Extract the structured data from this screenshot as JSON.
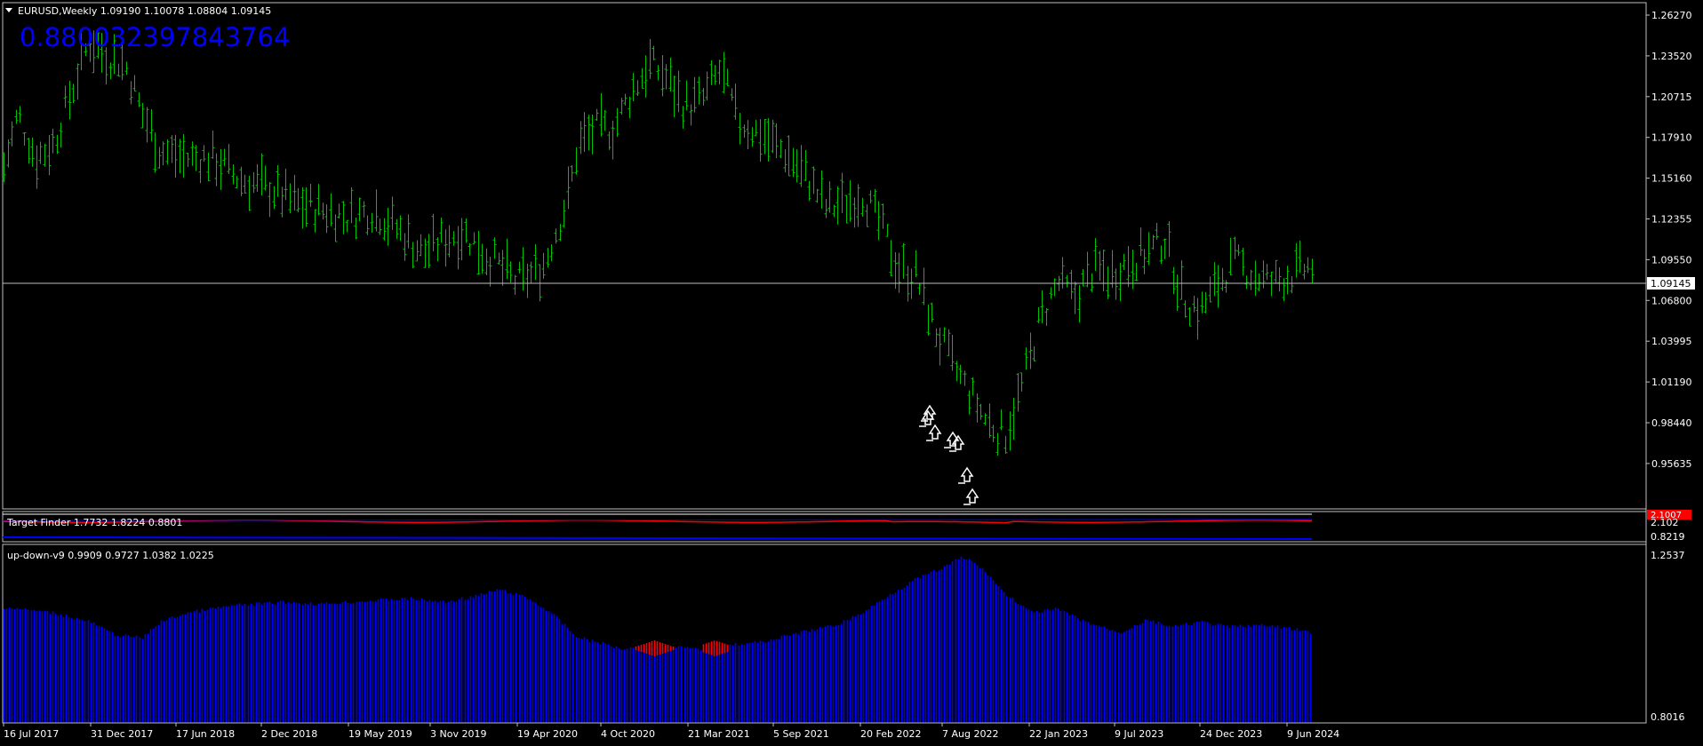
{
  "main": {
    "symbol_header": "EURUSD,Weekly  1.09190 1.10078 1.08804 1.09145",
    "big_value": "0.880032397843764",
    "price_axis": [
      "1.26270",
      "1.23520",
      "1.20715",
      "1.17910",
      "1.15160",
      "1.12355",
      "1.09550",
      "1.06800",
      "1.03995",
      "1.01190",
      "0.98440",
      "0.95635"
    ],
    "current_price": "1.09145",
    "colors": {
      "candles": "#00c000",
      "price_line": "#c0c0c0",
      "tag_bg": "#ffffff",
      "tag_text": "#000000",
      "arrows": "#ffffff"
    }
  },
  "indicator1": {
    "label": "Target Finder 1.7732 1.8224 0.8801",
    "axis": [
      "2.102",
      "0.8219"
    ],
    "tag": "2.1007",
    "colors": {
      "line_red": "#ff0000",
      "line_blue": "#0000ff",
      "tag_bg": "#ff0000"
    }
  },
  "indicator2": {
    "label": "up-down-v9 0.9909 0.9727 1.0382 1.0225",
    "axis": [
      "1.2537",
      "0.8016"
    ],
    "colors": {
      "bars_blue": "#0000ff",
      "bars_red": "#ff0000"
    }
  },
  "time_axis": [
    "16 Jul 2017",
    "31 Dec 2017",
    "17 Jun 2018",
    "2 Dec 2018",
    "19 May 2019",
    "3 Nov 2019",
    "19 Apr 2020",
    "4 Oct 2020",
    "21 Mar 2021",
    "5 Sep 2021",
    "20 Feb 2022",
    "7 Aug 2022",
    "22 Jan 2023",
    "9 Jul 2023",
    "24 Dec 2023",
    "9 Jun 2024"
  ],
  "chart_data": {
    "type": "line",
    "title": "EURUSD,Weekly",
    "x": [
      "16 Jul 2017",
      "31 Dec 2017",
      "17 Jun 2018",
      "2 Dec 2018",
      "19 May 2019",
      "3 Nov 2019",
      "19 Apr 2020",
      "4 Oct 2020",
      "21 Mar 2021",
      "5 Sep 2021",
      "20 Feb 2022",
      "7 Aug 2022",
      "22 Jan 2023",
      "9 Jul 2023",
      "24 Dec 2023",
      "9 Jun 2024"
    ],
    "series": [
      {
        "values": [
          1.16,
          1.245,
          1.16,
          1.14,
          1.12,
          1.1,
          1.085,
          1.18,
          1.225,
          1.17,
          1.115,
          0.975,
          1.085,
          1.095,
          1.09,
          1.09
        ]
      }
    ],
    "ylim": [
      0.95635,
      1.2627
    ]
  }
}
